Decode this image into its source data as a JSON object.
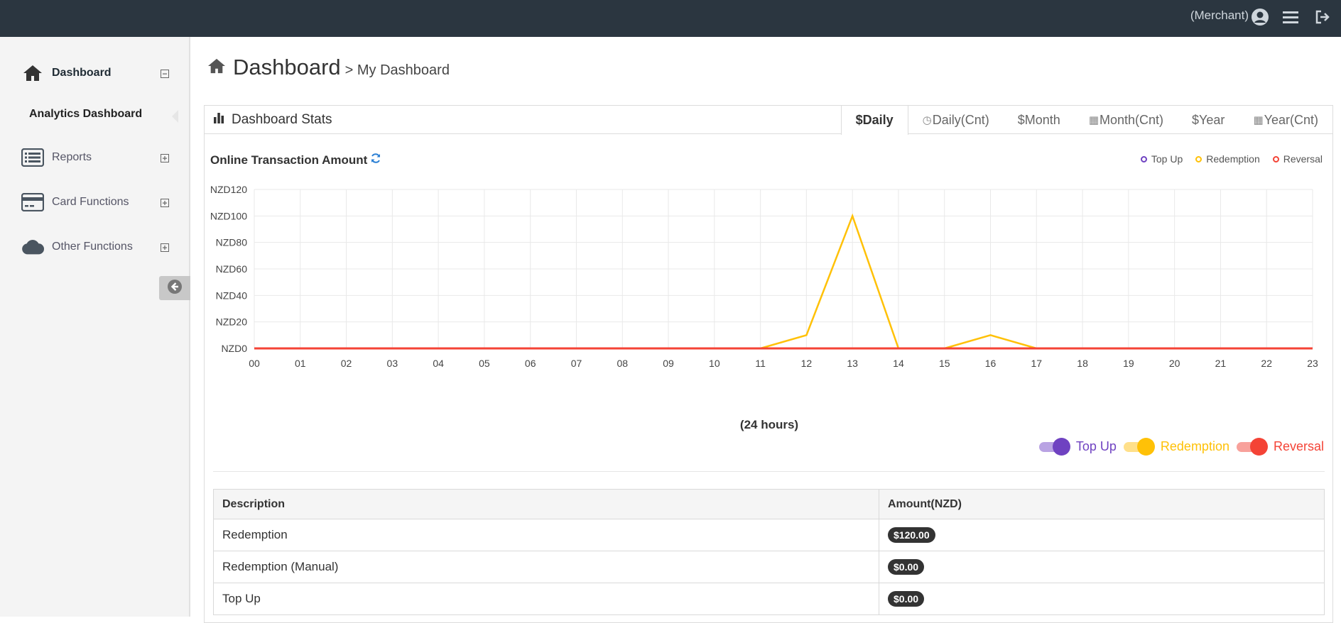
{
  "topbar": {
    "merchant_label": "(Merchant)",
    "icons": [
      "user-circle-icon",
      "hamburger-menu-icon",
      "logout-icon"
    ]
  },
  "sidebar": {
    "items": [
      {
        "label": "Dashboard",
        "icon": "home-icon",
        "expand": "minus"
      },
      {
        "label": "Reports",
        "icon": "list-icon",
        "expand": "plus"
      },
      {
        "label": "Card Functions",
        "icon": "credit-card-icon",
        "expand": "plus"
      },
      {
        "label": "Other Functions",
        "icon": "cloud-icon",
        "expand": "plus"
      }
    ],
    "sub_item": "Analytics Dashboard",
    "collapse_icon": "arrow-left-circle-icon"
  },
  "page": {
    "title": "Dashboard",
    "breadcrumb": "> My Dashboard"
  },
  "panel": {
    "title": "Dashboard Stats",
    "tabs": [
      {
        "label": "$Daily",
        "active": true
      },
      {
        "label": "Daily(Cnt)",
        "glyph": "clock-icon"
      },
      {
        "label": "$Month"
      },
      {
        "label": "Month(Cnt)",
        "glyph": "calendar-icon"
      },
      {
        "label": "$Year"
      },
      {
        "label": "Year(Cnt)",
        "glyph": "calendar-icon"
      }
    ]
  },
  "chart": {
    "title": "Online Transaction Amount",
    "x_caption": "(24 hours)"
  },
  "colors": {
    "topup": "#6f42c1",
    "redemption": "#ffc107",
    "reversal": "#f44336"
  },
  "chart_data": {
    "type": "line",
    "title": "Online Transaction Amount",
    "xlabel": "(24 hours)",
    "ylabel": "",
    "x": [
      "00",
      "01",
      "02",
      "03",
      "04",
      "05",
      "06",
      "07",
      "08",
      "09",
      "10",
      "11",
      "12",
      "13",
      "14",
      "15",
      "16",
      "17",
      "18",
      "19",
      "20",
      "21",
      "22",
      "23"
    ],
    "ylim": [
      0,
      120
    ],
    "yticks": [
      "NZD0",
      "NZD20",
      "NZD40",
      "NZD60",
      "NZD80",
      "NZD100",
      "NZD120"
    ],
    "grid": true,
    "legend": "top-right",
    "series": [
      {
        "name": "Top Up",
        "values": [
          0,
          0,
          0,
          0,
          0,
          0,
          0,
          0,
          0,
          0,
          0,
          0,
          0,
          0,
          0,
          0,
          0,
          0,
          0,
          0,
          0,
          0,
          0,
          0
        ]
      },
      {
        "name": "Redemption",
        "values": [
          0,
          0,
          0,
          0,
          0,
          0,
          0,
          0,
          0,
          0,
          0,
          0,
          10,
          100,
          0,
          0,
          10,
          0,
          0,
          0,
          0,
          0,
          0,
          0
        ]
      },
      {
        "name": "Reversal",
        "values": [
          0,
          0,
          0,
          0,
          0,
          0,
          0,
          0,
          0,
          0,
          0,
          0,
          0,
          0,
          0,
          0,
          0,
          0,
          0,
          0,
          0,
          0,
          0,
          0
        ]
      }
    ]
  },
  "toggles": [
    {
      "label": "Top Up",
      "on": true
    },
    {
      "label": "Redemption",
      "on": true
    },
    {
      "label": "Reversal",
      "on": true
    }
  ],
  "table": {
    "headers": [
      "Description",
      "Amount(NZD)"
    ],
    "rows": [
      {
        "description": "Redemption",
        "amount": "$120.00"
      },
      {
        "description": "Redemption (Manual)",
        "amount": "$0.00"
      },
      {
        "description": "Top Up",
        "amount": "$0.00"
      }
    ]
  }
}
